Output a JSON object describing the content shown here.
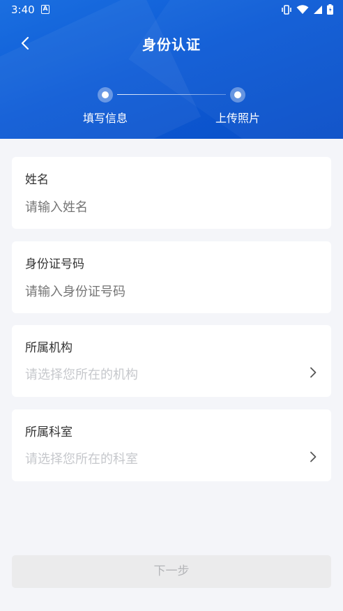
{
  "status_bar": {
    "time": "3:40",
    "notification_icon": "a-icon",
    "icons": [
      "vibrate-icon",
      "wifi-icon",
      "signal-icon",
      "battery-icon"
    ]
  },
  "header": {
    "title": "身份认证",
    "back_icon": "back-chevron-icon",
    "steps": [
      {
        "label": "填写信息"
      },
      {
        "label": "上传照片"
      }
    ]
  },
  "form": {
    "name": {
      "label": "姓名",
      "placeholder": "请输入姓名"
    },
    "id_number": {
      "label": "身份证号码",
      "placeholder": "请输入身份证号码"
    },
    "institution": {
      "label": "所属机构",
      "placeholder": "请选择您所在的机构"
    },
    "department": {
      "label": "所属科室",
      "placeholder": "请选择您所在的科室"
    }
  },
  "next_button": {
    "label": "下一步"
  },
  "colors": {
    "header_blue": "#0d5bd6",
    "background": "#f4f5f9",
    "placeholder": "#c6c8cc",
    "button_disabled": "#ebebec"
  }
}
